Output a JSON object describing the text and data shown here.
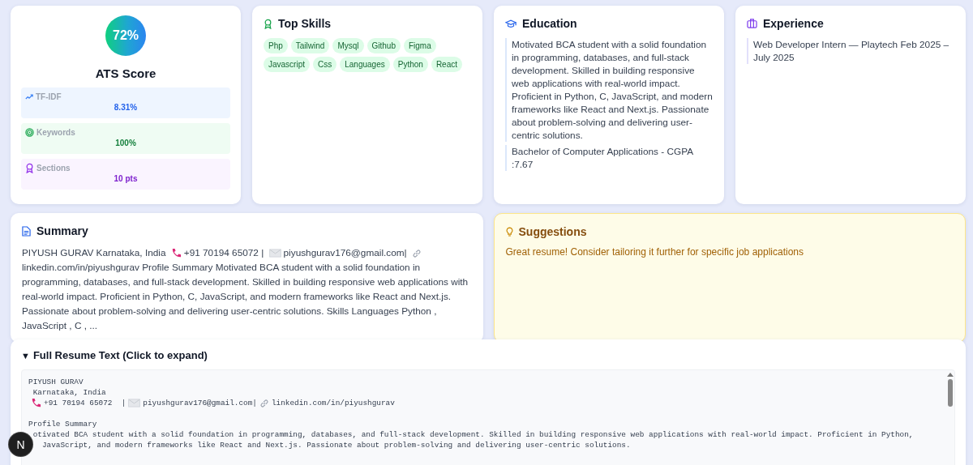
{
  "ats": {
    "score": "72%",
    "title": "ATS Score",
    "metrics": [
      {
        "kind": "tfidf",
        "label": "TF-IDF",
        "value": "8.31%"
      },
      {
        "kind": "keywords",
        "label": "Keywords",
        "value": "100%"
      },
      {
        "kind": "sections",
        "label": "Sections",
        "value": "10 pts"
      }
    ]
  },
  "skills": {
    "title": "Top Skills",
    "tags": [
      "Php",
      "Tailwind",
      "Mysql",
      "Github",
      "Figma",
      "Javascript",
      "Css",
      "Languages",
      "Python",
      "React"
    ]
  },
  "education": {
    "title": "Education",
    "entries": [
      "Motivated BCA student with a solid foundation in programming, databases, and full-stack development. Skilled in building responsive web applications with real-world impact. Proficient in Python, C, JavaScript, and modern frameworks like React and Next.js. Passionate about problem-solving and delivering user-centric solutions.",
      "Bachelor of Computer Applications - CGPA :7.67"
    ]
  },
  "experience": {
    "title": "Experience",
    "entries": [
      "Web Developer Intern — Playtech Feb 2025 – July 2025"
    ]
  },
  "summary": {
    "title": "Summary",
    "parts": [
      "PIYUSH GURAV Karnataka, India",
      "+91 70194 65072 |",
      "piyushgurav176@gmail.com|",
      "linkedin.com/in/piyushgurav Profile Summary Motivated BCA student with a solid foundation in programming, databases, and full-stack development. Skilled in building responsive web applications with real-world impact. Proficient in Python, C, JavaScript, and modern frameworks like React and Next.js. Passionate about problem-solving and delivering user-centric solutions. Skills Languages Python , JavaScript , C , ..."
    ]
  },
  "suggestions": {
    "title": "Suggestions",
    "text": "Great resume! Consider tailoring it further for specific job applications"
  },
  "full_text": {
    "marker": "▼",
    "title": "Full Resume Text (Click to expand)",
    "expanded": true,
    "name": "PIYUSH GURAV",
    "location": " Karnataka, India",
    "contact": [
      "+91 70194 65072  |",
      "piyushgurav176@gmail.com|",
      "linkedin.com/in/piyushgurav"
    ],
    "lines": [
      "Profile Summary",
      " otivated BCA student with a solid foundation in programming, databases, and full-stack development. Skilled in building responsive web applications with real-world impact. Proficient in Python,",
      "   JavaScript, and modern frameworks like React and Next.js. Passionate about problem-solving and delivering user-centric solutions."
    ]
  },
  "dev_badge": {
    "letter": "N"
  }
}
